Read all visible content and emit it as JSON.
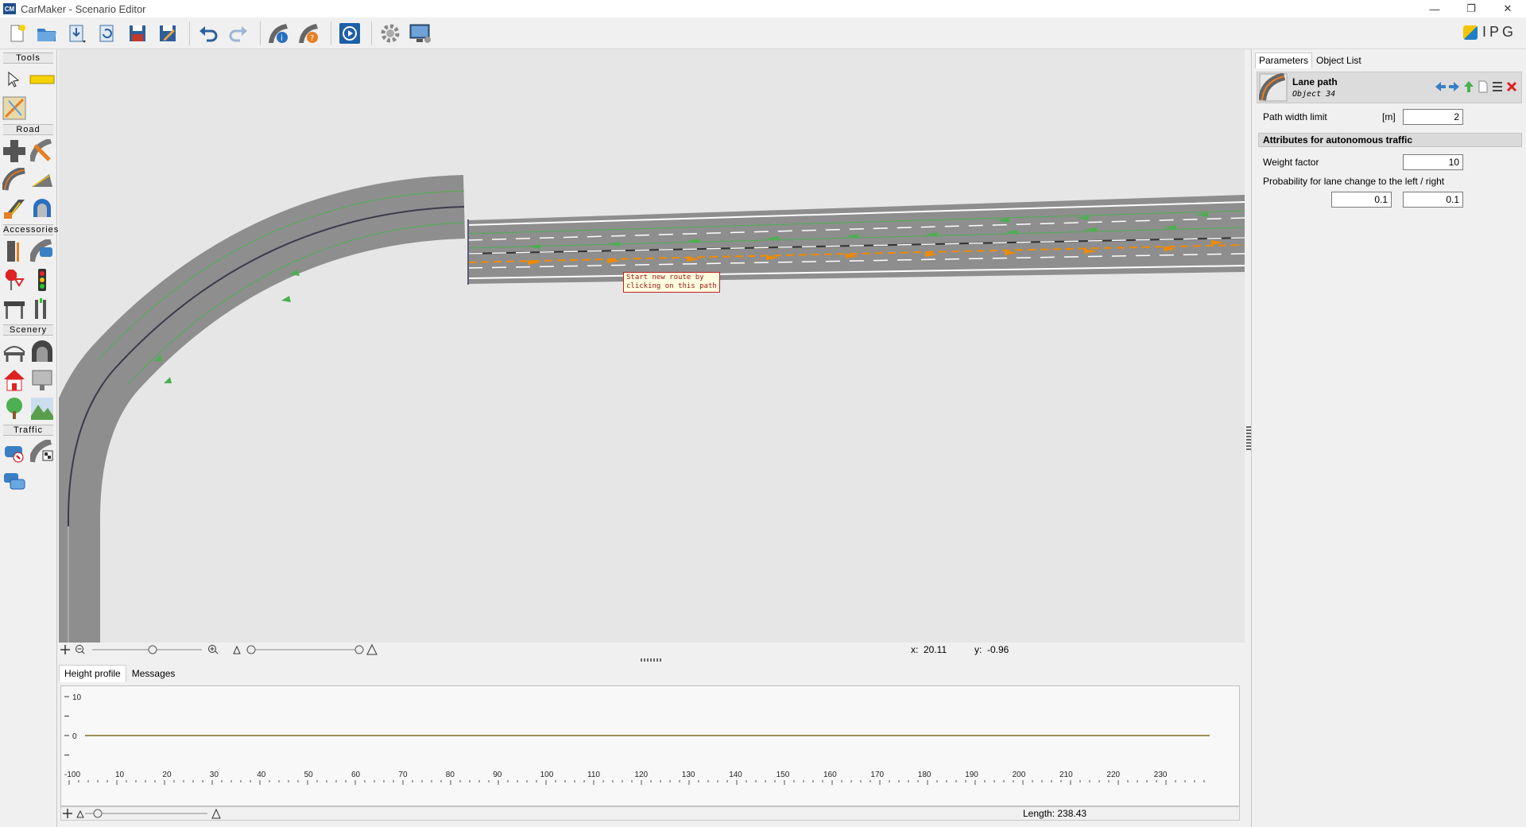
{
  "window": {
    "app_icon_label": "CM",
    "title": "CarMaker - Scenario Editor",
    "minimize": "—",
    "restore": "❐",
    "close": "✕"
  },
  "toolbar": {
    "buttons": [
      "new-icon",
      "open-icon",
      "import-icon",
      "reload-icon",
      "save-icon",
      "save-as-icon",
      "undo-icon",
      "redo-icon",
      "road-info-icon",
      "road-help-icon",
      "play-icon",
      "settings-icon",
      "display-icon"
    ],
    "logo_text": "IPG"
  },
  "palette": {
    "categories": {
      "tools": "Tools",
      "road": "Road",
      "accessories": "Accessories",
      "scenery": "Scenery",
      "traffic": "Traffic"
    }
  },
  "canvas": {
    "tooltip": "Start new route by\nclicking on this path",
    "x_label": "x:",
    "x_value": "20.11",
    "y_label": "y:",
    "y_value": "-0.96"
  },
  "bottom": {
    "tabs": [
      "Height profile",
      "Messages"
    ],
    "active_tab": "Height profile",
    "y_ticks": [
      "10",
      "0"
    ],
    "x_ticks": [
      "-100",
      "10",
      "20",
      "30",
      "40",
      "50",
      "60",
      "70",
      "80",
      "90",
      "100",
      "110",
      "120",
      "130",
      "140",
      "150",
      "160",
      "170",
      "180",
      "190",
      "200",
      "210",
      "220",
      "230"
    ],
    "length_label": "Length: 238.43"
  },
  "chart_data": {
    "type": "line",
    "title": "",
    "xlabel": "",
    "ylabel": "",
    "series": [
      {
        "x": [
          0,
          238.43
        ],
        "values": [
          0,
          0
        ]
      }
    ],
    "xlim": [
      0,
      238.43
    ],
    "ylim": [
      -10,
      10
    ],
    "colors": [
      "#7a6a1e"
    ]
  },
  "right_panel": {
    "tabs": [
      "Parameters",
      "Object List"
    ],
    "active_tab": "Parameters",
    "object_title": "Lane path",
    "object_subtitle": "Object 34",
    "path_width_label": "Path width limit",
    "path_width_unit": "[m]",
    "path_width_value": "2",
    "section_title": "Attributes for autonomous traffic",
    "weight_label": "Weight factor",
    "weight_value": "10",
    "lane_change_label": "Probability for lane change to the left / right",
    "lane_change_left": "0.1",
    "lane_change_right": "0.1"
  },
  "colors": {
    "road": "#8e8e8e",
    "lane_green": "#4caf50",
    "lane_orange": "#f08a00",
    "tooltip_border": "#b22222",
    "height_line": "#7a6a1e"
  }
}
